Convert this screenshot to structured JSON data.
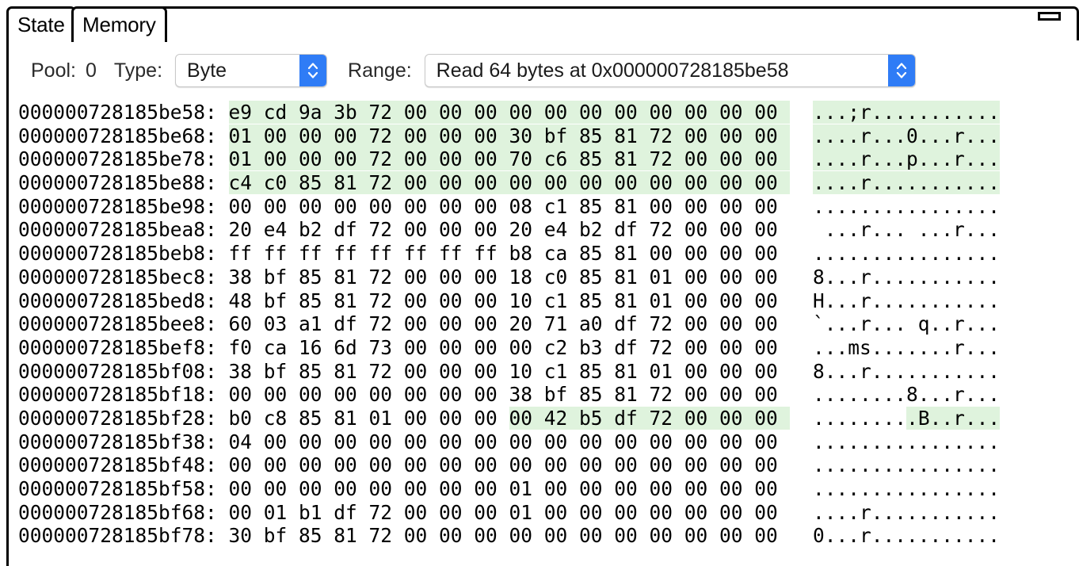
{
  "window": {
    "minimize_icon": "minimize-icon"
  },
  "tabs": [
    {
      "label": "State",
      "selected": false
    },
    {
      "label": "Memory",
      "selected": true
    }
  ],
  "toolbar": {
    "pool_label": "Pool:",
    "pool_value": "0",
    "type_label": "Type:",
    "type_value": "Byte",
    "type_options": [
      "Byte"
    ],
    "range_label": "Range:",
    "range_value": "Read 64 bytes at 0x000000728185be58",
    "stepper_icon": "chevron-up-down-icon"
  },
  "colors": {
    "highlight": "#dff3dd",
    "stepper_blue": "#2f7cf6",
    "text": "#000000",
    "border": "#000000"
  },
  "hexdump": {
    "bytes_per_row": 16,
    "rows": [
      {
        "address": "000000728185be58",
        "bytes": "e9 cd 9a 3b 72 00 00 00 00 00 00 00 00 00 00 00",
        "ascii": "...;r...........",
        "highlight": "full"
      },
      {
        "address": "000000728185be68",
        "bytes": "01 00 00 00 72 00 00 00 30 bf 85 81 72 00 00 00",
        "ascii": "....r...0...r...",
        "highlight": "full"
      },
      {
        "address": "000000728185be78",
        "bytes": "01 00 00 00 72 00 00 00 70 c6 85 81 72 00 00 00",
        "ascii": "....r...p...r...",
        "highlight": "full"
      },
      {
        "address": "000000728185be88",
        "bytes": "c4 c0 85 81 72 00 00 00 00 00 00 00 00 00 00 00",
        "ascii": "....r...........",
        "highlight": "full"
      },
      {
        "address": "000000728185be98",
        "bytes": "00 00 00 00 00 00 00 00 08 c1 85 81 00 00 00 00",
        "ascii": "................",
        "highlight": "none"
      },
      {
        "address": "000000728185bea8",
        "bytes": "20 e4 b2 df 72 00 00 00 20 e4 b2 df 72 00 00 00",
        "ascii": " ...r... ...r...",
        "highlight": "none"
      },
      {
        "address": "000000728185beb8",
        "bytes": "ff ff ff ff ff ff ff ff b8 ca 85 81 00 00 00 00",
        "ascii": "................",
        "highlight": "none"
      },
      {
        "address": "000000728185bec8",
        "bytes": "38 bf 85 81 72 00 00 00 18 c0 85 81 01 00 00 00",
        "ascii": "8...r...........",
        "highlight": "none"
      },
      {
        "address": "000000728185bed8",
        "bytes": "48 bf 85 81 72 00 00 00 10 c1 85 81 01 00 00 00",
        "ascii": "H...r...........",
        "highlight": "none"
      },
      {
        "address": "000000728185bee8",
        "bytes": "60 03 a1 df 72 00 00 00 20 71 a0 df 72 00 00 00",
        "ascii": "`...r... q..r...",
        "highlight": "none"
      },
      {
        "address": "000000728185bef8",
        "bytes": "f0 ca 16 6d 73 00 00 00 00 c2 b3 df 72 00 00 00",
        "ascii": "...ms.......r...",
        "highlight": "none"
      },
      {
        "address": "000000728185bf08",
        "bytes": "38 bf 85 81 72 00 00 00 10 c1 85 81 01 00 00 00",
        "ascii": "8...r...........",
        "highlight": "none"
      },
      {
        "address": "000000728185bf18",
        "bytes": "00 00 00 00 00 00 00 00 38 bf 85 81 72 00 00 00",
        "ascii": "........8...r...",
        "highlight": "none"
      },
      {
        "address": "000000728185bf28",
        "bytes": "b0 c8 85 81 01 00 00 00 00 42 b5 df 72 00 00 00",
        "ascii": ".........B..r...",
        "highlight": "tail8"
      },
      {
        "address": "000000728185bf38",
        "bytes": "04 00 00 00 00 00 00 00 00 00 00 00 00 00 00 00",
        "ascii": "................",
        "highlight": "none"
      },
      {
        "address": "000000728185bf48",
        "bytes": "00 00 00 00 00 00 00 00 00 00 00 00 00 00 00 00",
        "ascii": "................",
        "highlight": "none"
      },
      {
        "address": "000000728185bf58",
        "bytes": "00 00 00 00 00 00 00 00 01 00 00 00 00 00 00 00",
        "ascii": "................",
        "highlight": "none"
      },
      {
        "address": "000000728185bf68",
        "bytes": "00 01 b1 df 72 00 00 00 01 00 00 00 00 00 00 00",
        "ascii": "....r...........",
        "highlight": "none"
      },
      {
        "address": "000000728185bf78",
        "bytes": "30 bf 85 81 72 00 00 00 00 00 00 00 00 00 00 00",
        "ascii": "0...r...........",
        "highlight": "none"
      }
    ]
  }
}
